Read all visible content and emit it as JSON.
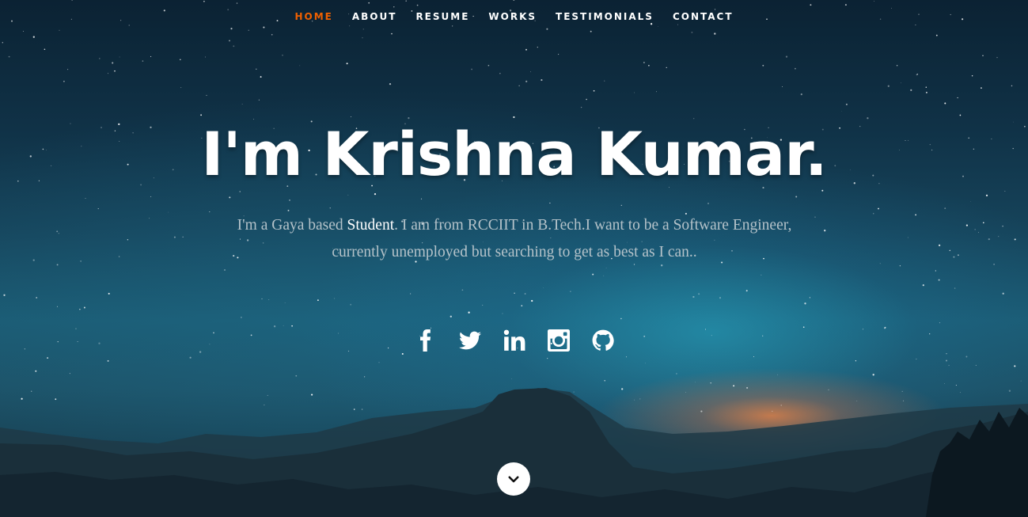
{
  "nav": {
    "items": [
      {
        "label": "HOME",
        "active": true
      },
      {
        "label": "ABOUT",
        "active": false
      },
      {
        "label": "RESUME",
        "active": false
      },
      {
        "label": "WORKS",
        "active": false
      },
      {
        "label": "TESTIMONIALS",
        "active": false
      },
      {
        "label": "CONTACT",
        "active": false
      }
    ],
    "active_color": "#f06000"
  },
  "hero": {
    "title": "I'm Krishna Kumar.",
    "desc_before": "I'm a Gaya based ",
    "desc_highlight": "Student",
    "desc_after": ". I am from RCCIIT in B.Tech.I want to be a Software Engineer, currently unemployed but searching to get as best as I can.."
  },
  "social": {
    "icons": [
      "facebook-icon",
      "twitter-icon",
      "linkedin-icon",
      "instagram-icon",
      "github-icon"
    ]
  },
  "scroll_down": {
    "icon": "chevron-down-icon"
  }
}
